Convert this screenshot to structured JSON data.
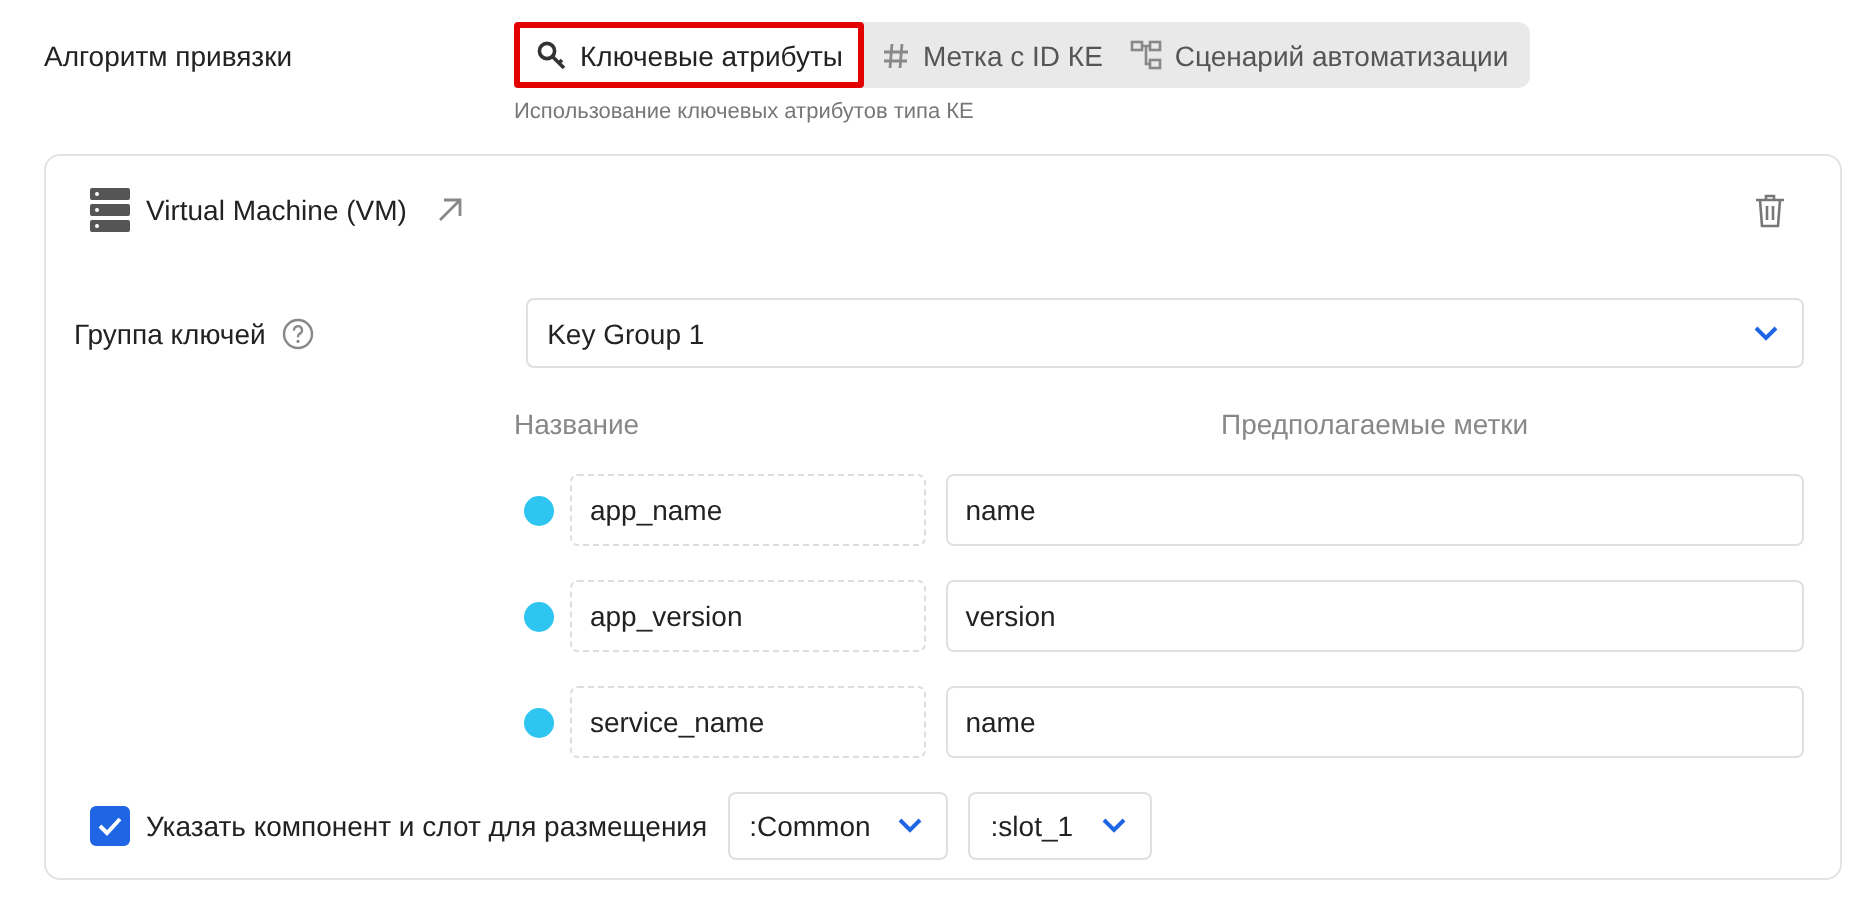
{
  "algorithm": {
    "label": "Алгоритм привязки",
    "tabs": [
      {
        "kind": "key",
        "label": "Ключевые атрибуты",
        "selected": true
      },
      {
        "kind": "hash",
        "label": "Метка с ID КЕ",
        "selected": false
      },
      {
        "kind": "flow",
        "label": "Сценарий автоматизации",
        "selected": false
      }
    ],
    "hint": "Использование ключевых атрибутов типа КЕ"
  },
  "card": {
    "title": "Virtual Machine (VM)",
    "key_group": {
      "label": "Группа ключей",
      "value": "Key Group 1"
    },
    "columns": [
      "Название",
      "Предполагаемые метки"
    ],
    "rows": [
      {
        "color": "#2ec5f0",
        "name": "app_name",
        "value": "name"
      },
      {
        "color": "#2ec5f0",
        "name": "app_version",
        "value": "version"
      },
      {
        "color": "#2ec5f0",
        "name": "service_name",
        "value": "name"
      }
    ],
    "placement": {
      "checked": true,
      "label": "Указать компонент и слот для размещения",
      "component": ":Common",
      "slot": ":slot_1"
    }
  }
}
